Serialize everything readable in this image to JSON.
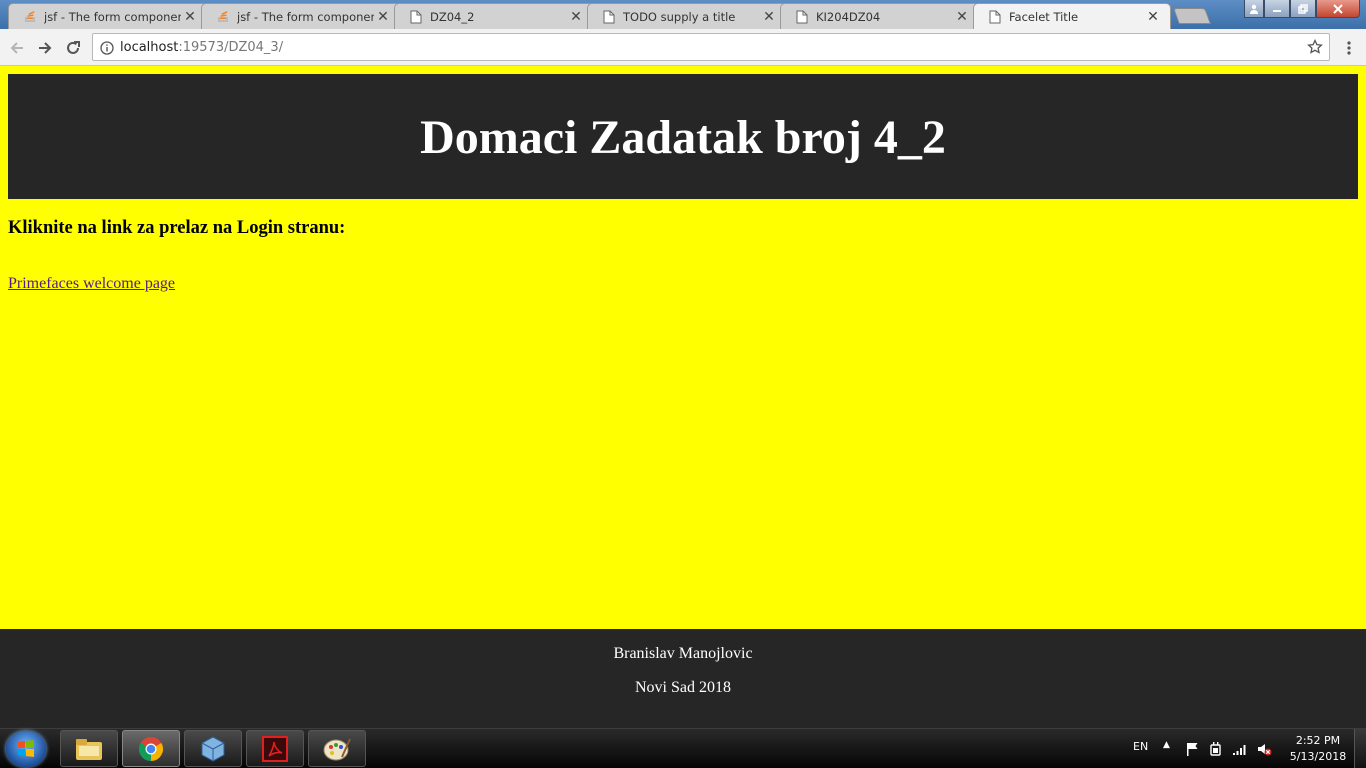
{
  "browser": {
    "tabs": [
      {
        "label": "jsf - The form component",
        "icon": "stackoverflow-icon"
      },
      {
        "label": "jsf - The form component",
        "icon": "stackoverflow-icon"
      },
      {
        "label": "DZ04_2",
        "icon": "document-icon"
      },
      {
        "label": "TODO supply a title",
        "icon": "document-icon"
      },
      {
        "label": "KI204DZ04",
        "icon": "document-icon"
      },
      {
        "label": "Facelet Title",
        "icon": "document-icon",
        "active": true
      }
    ],
    "url": {
      "host": "localhost",
      "rest": ":19573/DZ04_3/"
    }
  },
  "page": {
    "header_title": "Domaci Zadatak broj 4_2",
    "instruction": "Kliknite na link za prelaz na Login stranu:",
    "link_text": "Primefaces welcome page",
    "footer": {
      "author": "Branislav Manojlovic",
      "place_year": "Novi Sad 2018"
    },
    "colors": {
      "background": "#ffff00",
      "header_footer": "#262626",
      "link": "#551a8b"
    }
  },
  "taskbar": {
    "apps": [
      "file-explorer-icon",
      "chrome-icon",
      "virtualbox-icon",
      "acrobat-icon",
      "paint-icon"
    ],
    "language": "EN",
    "time": "2:52 PM",
    "date": "5/13/2018"
  }
}
